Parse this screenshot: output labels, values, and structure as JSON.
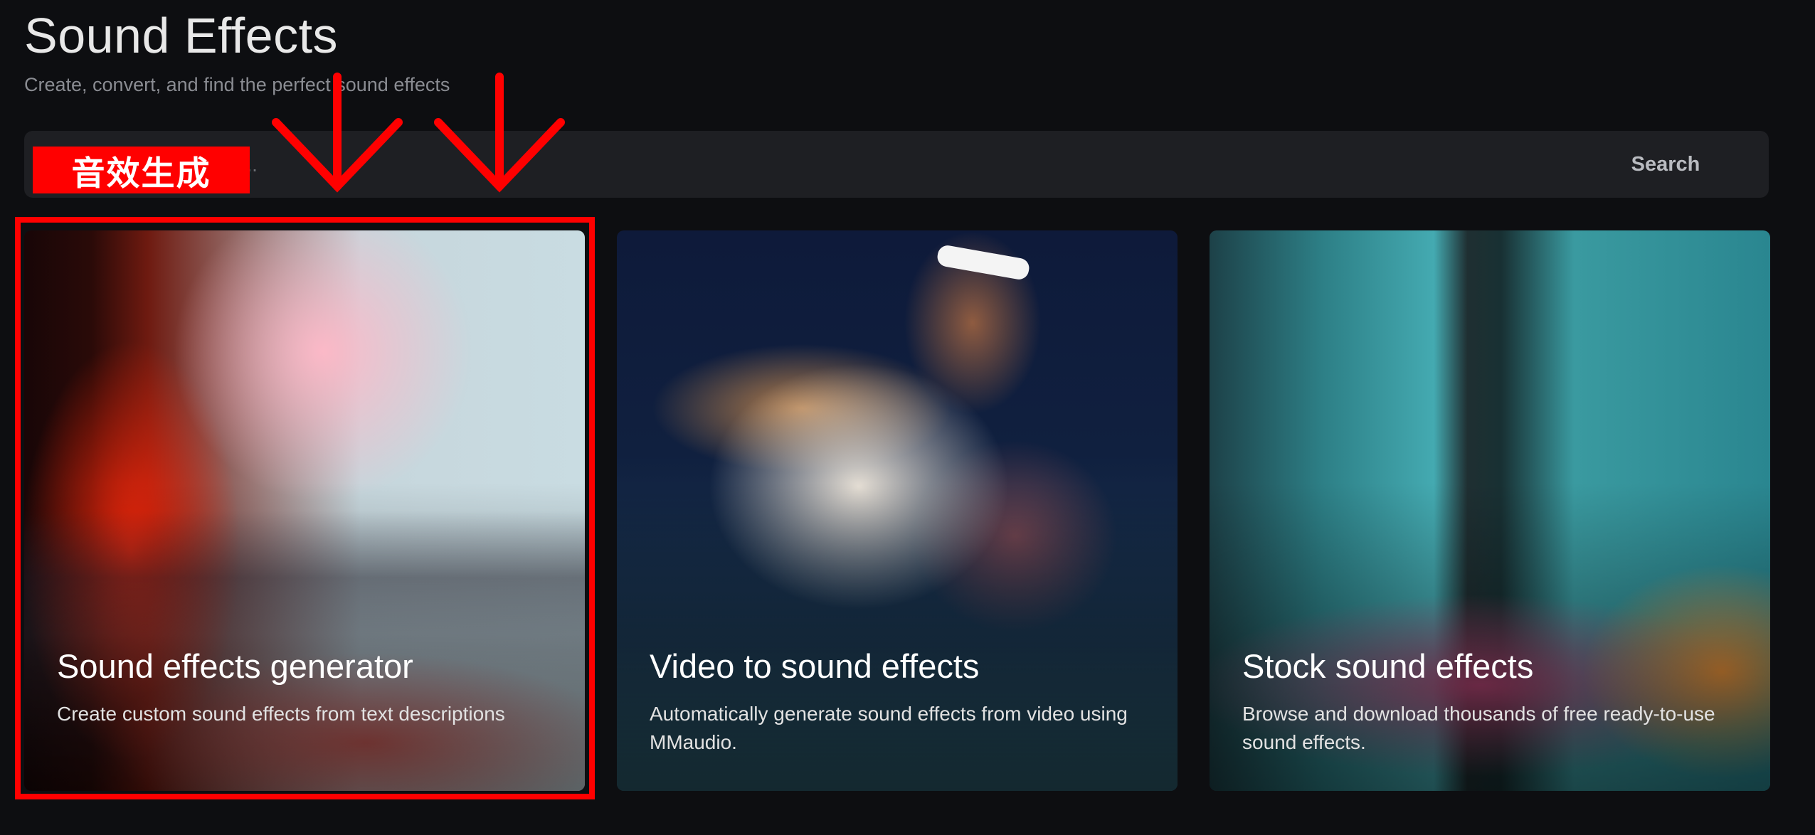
{
  "header": {
    "title": "Sound Effects",
    "subtitle": "Create, convert, and find the perfect sound effects"
  },
  "search": {
    "placeholder": "Search sound effects...",
    "button_label": "Search"
  },
  "annotation": {
    "label": "音效生成",
    "color": "#ff0000"
  },
  "cards": [
    {
      "title": "Sound effects generator",
      "description": "Create custom sound effects from text descriptions"
    },
    {
      "title": "Video to sound effects",
      "description": "Automatically generate sound effects from video using MMaudio."
    },
    {
      "title": "Stock sound effects",
      "description": "Browse and download thousands of free ready-to-use sound effects."
    }
  ]
}
